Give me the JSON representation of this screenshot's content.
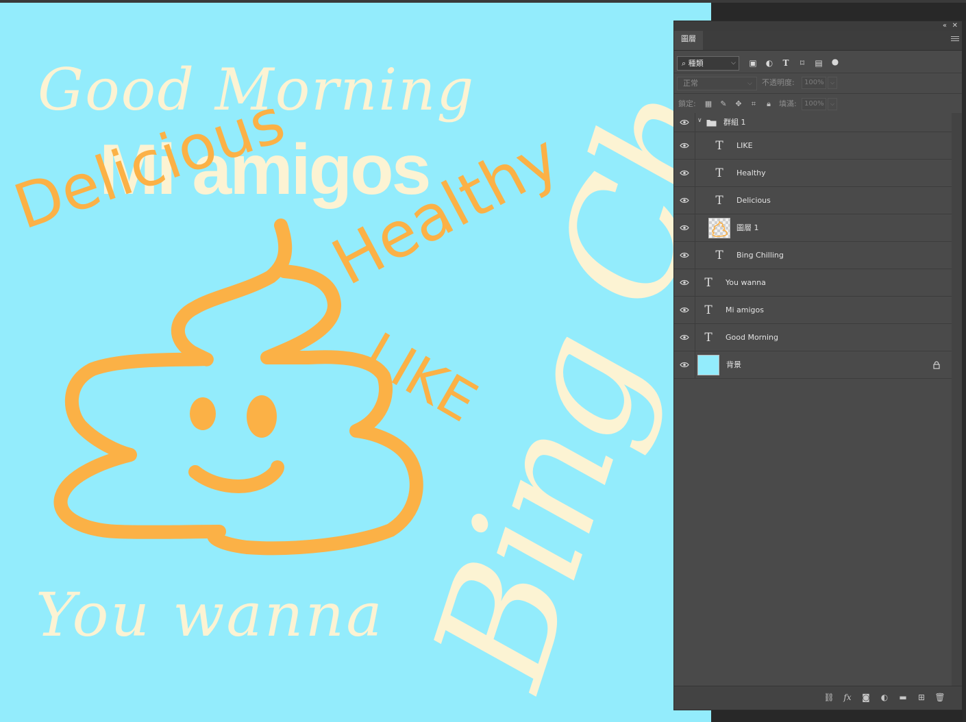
{
  "canvas": {
    "background_color": "#93ecfc",
    "text_cream": "#fcf3d3",
    "text_orange": "#fbb146",
    "words": {
      "good_morning": "Good Morning",
      "mi_amigos": "Mi amigos",
      "delicious": "Delicious",
      "healthy": "Healthy",
      "like": "LIKE",
      "you_wanna": "You wanna",
      "bing_chilling": "Bing Ch"
    },
    "drawing": "smiling-poop-doodle"
  },
  "panel": {
    "collapse_icon": "double-chevron-left-icon",
    "close_icon": "close-icon",
    "tab_label": "圖層",
    "menu_icon": "hamburger-menu-icon",
    "filter": {
      "search_icon": "search-icon",
      "kind_label": "種類",
      "icons": [
        "image-filter-icon",
        "adjustment-filter-icon",
        "type-filter-icon",
        "shape-filter-icon",
        "smart-object-filter-icon",
        "filter-toggle-icon"
      ]
    },
    "blend": {
      "mode": "正常",
      "opacity_label": "不透明度:",
      "opacity_value": "100%"
    },
    "lock": {
      "label": "鎖定:",
      "icons": [
        "lock-transparent-icon",
        "lock-paint-icon",
        "lock-move-icon",
        "lock-artboard-icon",
        "lock-all-icon"
      ],
      "fill_label": "填滿:",
      "fill_value": "100%"
    },
    "layers": [
      {
        "name": "群組 1",
        "kind": "group",
        "indent": 0
      },
      {
        "name": "LIKE",
        "kind": "text",
        "indent": 1
      },
      {
        "name": "Healthy",
        "kind": "text",
        "indent": 1
      },
      {
        "name": "Delicious",
        "kind": "text",
        "indent": 1
      },
      {
        "name": "圖層 1",
        "kind": "pixel",
        "indent": 1
      },
      {
        "name": "Bing Chilling",
        "kind": "text",
        "indent": 1
      },
      {
        "name": "You wanna",
        "kind": "text",
        "indent": 0
      },
      {
        "name": "Mi amigos",
        "kind": "text",
        "indent": 0
      },
      {
        "name": "Good Morning",
        "kind": "text",
        "indent": 0
      },
      {
        "name": "背景",
        "kind": "background",
        "indent": 0,
        "locked": true
      }
    ],
    "bottom_icons": [
      "link-layers-icon",
      "fx-icon",
      "add-mask-icon",
      "adjustment-layer-icon",
      "new-group-icon",
      "new-layer-icon",
      "trash-icon"
    ]
  }
}
